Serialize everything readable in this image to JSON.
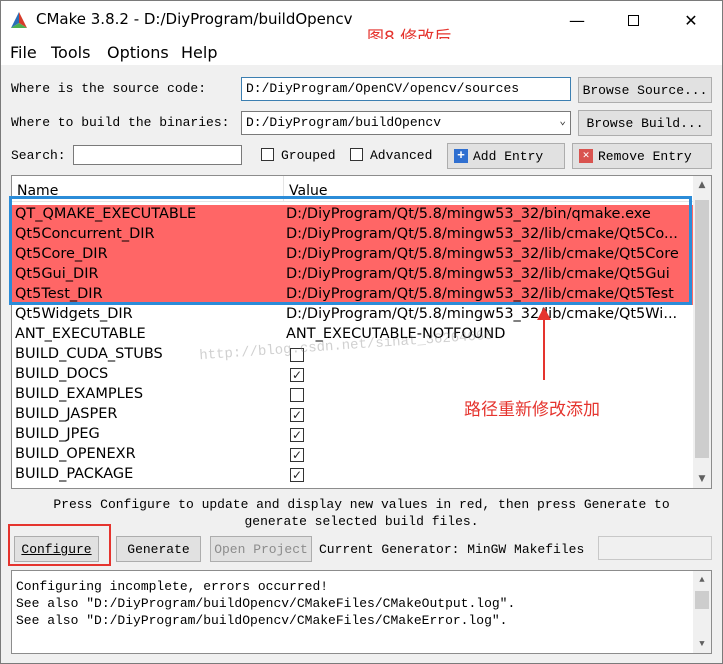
{
  "window": {
    "title": "CMake 3.8.2 - D:/DiyProgram/buildOpencv",
    "annotation_title": "图8  修改后"
  },
  "menu": [
    "File",
    "Tools",
    "Options",
    "Help"
  ],
  "source": {
    "label": "Where is the source code:",
    "value": "D:/DiyProgram/OpenCV/opencv/sources",
    "button": "Browse Source..."
  },
  "build": {
    "label": "Where to build the binaries:",
    "value": "D:/DiyProgram/buildOpencv",
    "button": "Browse Build..."
  },
  "search": {
    "label": "Search:",
    "value": "",
    "grouped_label": "Grouped",
    "advanced_label": "Advanced",
    "add_entry": "Add Entry",
    "remove_entry": "Remove Entry"
  },
  "table": {
    "headers": [
      "Name",
      "Value"
    ],
    "rows": [
      {
        "name": "QT_QMAKE_EXECUTABLE",
        "value": "D:/DiyProgram/Qt/5.8/mingw53_32/bin/qmake.exe",
        "highlight": true
      },
      {
        "name": "Qt5Concurrent_DIR",
        "value": "D:/DiyProgram/Qt/5.8/mingw53_32/lib/cmake/Qt5Co...",
        "highlight": true
      },
      {
        "name": "Qt5Core_DIR",
        "value": "D:/DiyProgram/Qt/5.8/mingw53_32/lib/cmake/Qt5Core",
        "highlight": true
      },
      {
        "name": "Qt5Gui_DIR",
        "value": "D:/DiyProgram/Qt/5.8/mingw53_32/lib/cmake/Qt5Gui",
        "highlight": true
      },
      {
        "name": "Qt5Test_DIR",
        "value": "D:/DiyProgram/Qt/5.8/mingw53_32/lib/cmake/Qt5Test",
        "highlight": true
      },
      {
        "name": "Qt5Widgets_DIR",
        "value": "D:/DiyProgram/Qt/5.8/mingw53_32/lib/cmake/Qt5Wi...",
        "highlight": false
      },
      {
        "name": "ANT_EXECUTABLE",
        "value": "ANT_EXECUTABLE-NOTFOUND",
        "highlight": false
      },
      {
        "name": "BUILD_CUDA_STUBS",
        "checked": false
      },
      {
        "name": "BUILD_DOCS",
        "checked": true
      },
      {
        "name": "BUILD_EXAMPLES",
        "checked": false
      },
      {
        "name": "BUILD_JASPER",
        "checked": true
      },
      {
        "name": "BUILD_JPEG",
        "checked": true
      },
      {
        "name": "BUILD_OPENEXR",
        "checked": true
      },
      {
        "name": "BUILD_PACKAGE",
        "checked": true
      }
    ]
  },
  "watermark": "http://blog.csdn.net/sinat_36264666",
  "annotation_note": "路径重新修改添加",
  "hint": {
    "line1": "Press Configure to update and display new values in red, then press Generate to",
    "line2": "generate selected build files."
  },
  "actions": {
    "configure": "Configure",
    "generate": "Generate",
    "open_project": "Open Project",
    "generator_label": "Current Generator: MinGW Makefiles"
  },
  "console": [
    "Configuring incomplete, errors occurred!",
    "See also \"D:/DiyProgram/buildOpencv/CMakeFiles/CMakeOutput.log\".",
    "See also \"D:/DiyProgram/buildOpencv/CMakeFiles/CMakeError.log\"."
  ],
  "colors": {
    "highlight_row": "#ff6666",
    "annotation_red": "#e5342e",
    "annotation_blue": "#2b8cd8"
  }
}
